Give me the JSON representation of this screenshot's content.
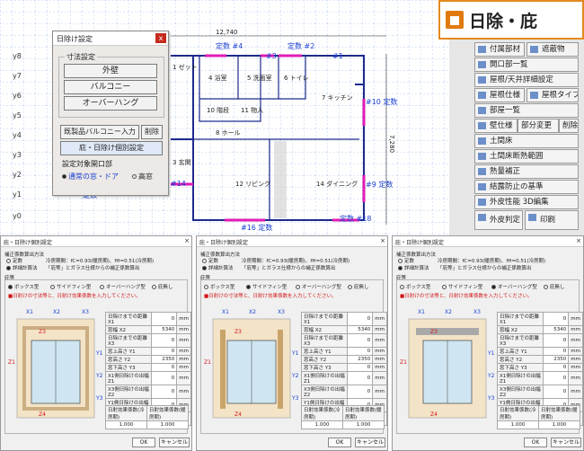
{
  "cad": {
    "dimension_top": "12,740",
    "dimension_right": "7,280",
    "y_labels": [
      "y8",
      "y7",
      "y6",
      "y5",
      "y4",
      "y3",
      "y2",
      "y1",
      "y0"
    ],
    "rooms": {
      "r1": "1 ゼット",
      "r4": "4 浴室",
      "r5": "5 洗面室",
      "r6": "6 トイレ",
      "r7": "7 キッチン",
      "r8": "8 ホール",
      "r10": "10 階段",
      "r11": "11 物入",
      "r12": "12 リビング",
      "r14": "14 ダイニング",
      "r3": "3 玄関"
    },
    "tags": {
      "t4": "定数\n#4",
      "t3": "#3",
      "t2": "定数\n#2",
      "t1": "#1",
      "t10": "#10\n定数",
      "t9": "#9\n定数",
      "t14": "#14",
      "t18": "定数\n#18",
      "t16": "#16\n定数",
      "t_left": "定数"
    }
  },
  "dialog": {
    "title": "日除け設定",
    "close_glyph": "x",
    "section_dims": "寸法設定",
    "btn_eave": "外壁",
    "btn_balcony": "バルコニー",
    "btn_overhang": "オーバーハング",
    "btn_ready": "既製品バルコニー入力",
    "btn_delete": "削除",
    "btn_ceil": "庇・日除け個別設定",
    "section_target": "設定対象開口部",
    "radio_normal": "通常の窓・ドア",
    "radio_high": "高窓"
  },
  "logo": {
    "text": "日除・庇"
  },
  "right_buttons": [
    "付属部材",
    "遮蔽物",
    "開口部一覧",
    "屋根/天井詳細設定",
    "屋根仕様",
    "屋根タイプ",
    "部屋一覧",
    "壁仕様",
    "部分変更",
    "削除",
    "土間床",
    "土間床断熱範囲",
    "熱量補正",
    "結露防止の基準",
    "外皮性能 3D編集",
    "外皮判定",
    "印刷"
  ],
  "bottom": {
    "title": "庇・日除け個別設定",
    "calc_method": "補正係数算出方法",
    "opt_fixed": "定数",
    "opt_detail": "詳細計算法",
    "note1": "冷房期間：fC=0.93(暖房期)、fH=0.51(冷房期)",
    "note2": "「庇等」とガラス仕様からの補正係数算出",
    "section_eave": "庇等",
    "types": [
      "ボックス型",
      "サイドフィン型",
      "オーバーハング型",
      "庇無し"
    ],
    "notice": "■日射けの寸法等と、日射け効果係数を入力してください。",
    "rows": [
      {
        "label": "日除けまでの距離 X1",
        "value": "0",
        "unit": "mm"
      },
      {
        "label": "窓幅 X2",
        "value": "5340",
        "unit": "mm"
      },
      {
        "label": "日除けまでの距離 X3",
        "value": "0",
        "unit": "mm"
      },
      {
        "label": "窓上高さ Y1",
        "value": "0",
        "unit": "mm"
      },
      {
        "label": "窓高さ Y2",
        "value": "2350",
        "unit": "mm"
      },
      {
        "label": "窓下高さ Y3",
        "value": "0",
        "unit": "mm"
      },
      {
        "label": "X1側日除けの出幅 Z1",
        "value": "0",
        "unit": "mm"
      },
      {
        "label": "X3側日除けの出幅 Z2",
        "value": "0",
        "unit": "mm"
      },
      {
        "label": "Y1側日除けの出幅 Z3",
        "value": "0",
        "unit": "mm"
      },
      {
        "label": "Y3側日除けの出幅 Z4",
        "value": "0",
        "unit": "mm"
      }
    ],
    "coef_cool_label": "日射効果係数(冷房期)",
    "coef_heat_label": "日射効果係数(暖房期)",
    "coef_cool": "1.000",
    "coef_heat": "1.000",
    "ok": "OK",
    "cancel": "キャンセル"
  }
}
